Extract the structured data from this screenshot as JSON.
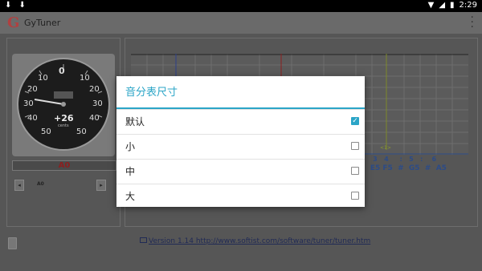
{
  "statusbar": {
    "time": "2:29"
  },
  "app": {
    "logo": "G",
    "title": "GyTuner"
  },
  "tuner": {
    "cents_reading": "+26",
    "cents_unit": "cents",
    "scale_labels_left": [
      "10",
      "20",
      "30",
      "40",
      "50"
    ],
    "scale_labels_right": [
      "10",
      "20",
      "30",
      "40",
      "50"
    ],
    "scale_zero": "0",
    "note": "A0",
    "small_button_label": "A0"
  },
  "chart": {
    "marker": "<1>",
    "row1": [
      ":",
      "3",
      "4",
      ":",
      "5",
      ":",
      "6"
    ],
    "row2": [
      "#",
      "E5",
      "F5",
      "#",
      "G5",
      "#",
      "A5"
    ]
  },
  "footer": {
    "version_link": "Version 1.14 http://www.softist.com/software/tuner/tuner.htm"
  },
  "dialog": {
    "title": "音分表尺寸",
    "options": [
      {
        "label": "默认",
        "checked": true
      },
      {
        "label": "小",
        "checked": false
      },
      {
        "label": "中",
        "checked": false
      },
      {
        "label": "大",
        "checked": false
      }
    ]
  },
  "colors": {
    "accent": "#2ba5c7",
    "note_red": "#8b1f1f",
    "note_blue": "#2c4b87"
  }
}
